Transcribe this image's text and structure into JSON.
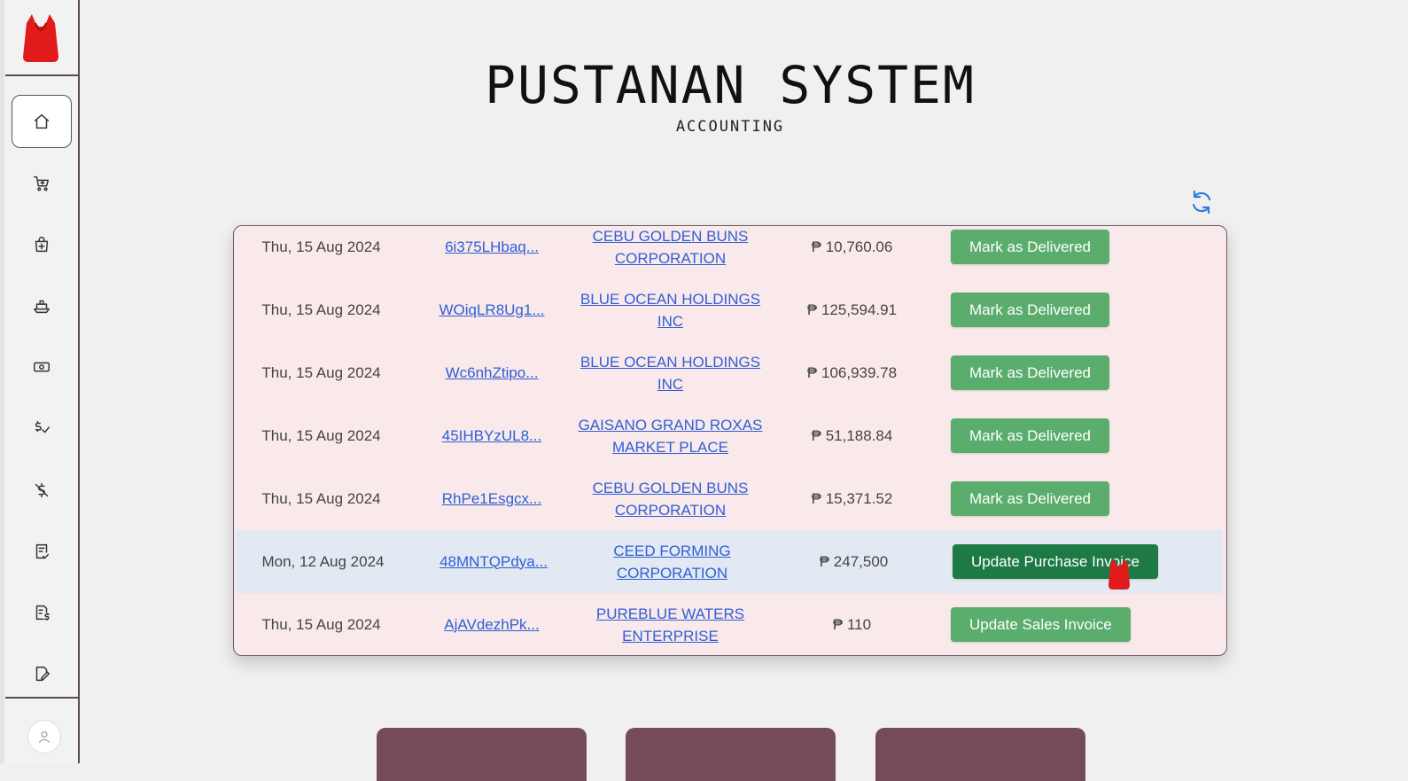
{
  "app": {
    "title": "PUSTANAN SYSTEM",
    "subtitle": "ACCOUNTING"
  },
  "colors": {
    "sidebar_border": "#5b4a52",
    "row_bg": "#fae9ea",
    "row_highlight": "#e3e9f2",
    "button_green": "#5aad6c",
    "button_dark_green": "#1d7a45",
    "link_blue": "#2e5fd6",
    "refresh_blue": "#2f7be0",
    "card_maroon": "#754b5a",
    "logo_red": "#e11b1b"
  },
  "sidebar": {
    "items": [
      {
        "icon": "home-icon",
        "active": true
      },
      {
        "icon": "cart-plus-icon"
      },
      {
        "icon": "shopping-bag-plus-icon"
      },
      {
        "icon": "ship-icon"
      },
      {
        "icon": "cash-icon"
      },
      {
        "icon": "dollar-check-icon"
      },
      {
        "icon": "dollar-off-icon"
      },
      {
        "icon": "checklist-icon"
      },
      {
        "icon": "report-money-icon"
      },
      {
        "icon": "file-edit-icon"
      }
    ]
  },
  "table": {
    "rows": [
      {
        "date": "Thu, 15 Aug 2024",
        "id": "6i375LHbaq...",
        "customer_l1": "CEBU GOLDEN BUNS",
        "customer_l2": "CORPORATION",
        "amount": "₱ 10,760.06",
        "action": "Mark as Delivered"
      },
      {
        "date": "Thu, 15 Aug 2024",
        "id": "WOiqLR8Ug1...",
        "customer_l1": "BLUE OCEAN HOLDINGS",
        "customer_l2": "INC",
        "amount": "₱ 125,594.91",
        "action": "Mark as Delivered"
      },
      {
        "date": "Thu, 15 Aug 2024",
        "id": "Wc6nhZtipo...",
        "customer_l1": "BLUE OCEAN HOLDINGS",
        "customer_l2": "INC",
        "amount": "₱ 106,939.78",
        "action": "Mark as Delivered"
      },
      {
        "date": "Thu, 15 Aug 2024",
        "id": "45IHBYzUL8...",
        "customer_l1": "GAISANO GRAND ROXAS",
        "customer_l2": "MARKET PLACE",
        "amount": "₱ 51,188.84",
        "action": "Mark as Delivered"
      },
      {
        "date": "Thu, 15 Aug 2024",
        "id": "RhPe1Esgcx...",
        "customer_l1": "CEBU GOLDEN BUNS",
        "customer_l2": "CORPORATION",
        "amount": "₱ 15,371.52",
        "action": "Mark as Delivered"
      },
      {
        "date": "Mon, 12 Aug 2024",
        "id": "48MNTQPdya...",
        "customer_l1": "CEED FORMING",
        "customer_l2": "CORPORATION",
        "amount": "₱ 247,500",
        "action": "Update Purchase Invoice",
        "highlighted": true
      },
      {
        "date": "Thu, 15 Aug 2024",
        "id": "AjAVdezhPk...",
        "customer_l1": "PUREBLUE WATERS",
        "customer_l2": "ENTERPRISE",
        "amount": "₱ 110",
        "action": "Update Sales Invoice"
      }
    ]
  }
}
